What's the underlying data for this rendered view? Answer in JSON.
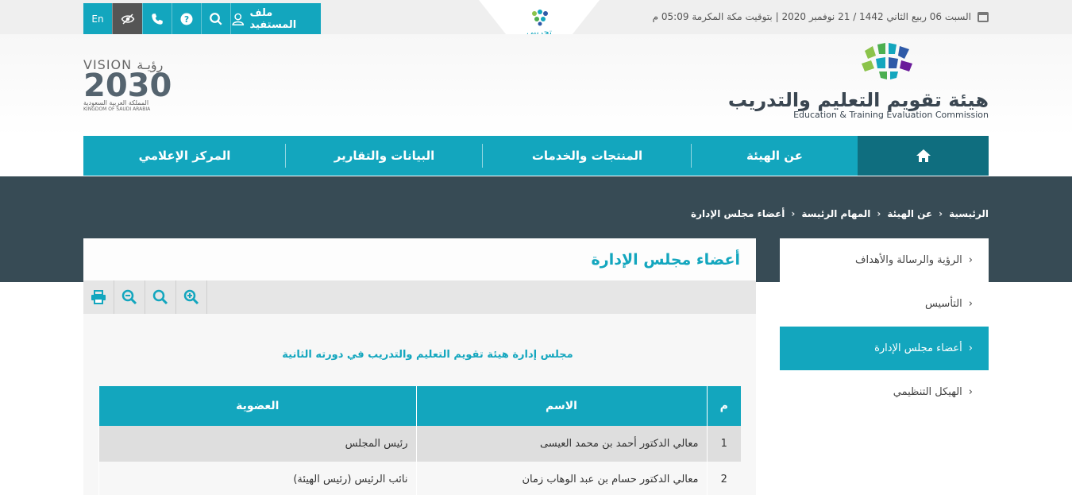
{
  "topbar": {
    "date_text": "السبت 06 ربيع الثاني 1442 / 21 نوفمبر 2020 | بتوقيت مكة المكرمة 05:09 م",
    "lang_label": "En",
    "profile_label": "ملف المستفيد",
    "tajribi_label": "تجريبي",
    "icons": [
      "accessibility-icon",
      "phone-icon",
      "help-icon",
      "search-icon",
      "user-icon"
    ]
  },
  "logo": {
    "ar": "هيئة تقويم التعليم والتدريب",
    "en": "Education & Training Evaluation Commission"
  },
  "vision": {
    "line1": "VISION رؤيـة",
    "line2": "2030",
    "line3": "المملكة العربية السعودية",
    "line4": "KINGDOM OF SAUDI ARABIA"
  },
  "nav": {
    "items": [
      "عن الهيئة",
      "المنتجات والخدمات",
      "البيانات والتقارير",
      "المركز الإعلامي"
    ]
  },
  "breadcrumb": [
    "الرئيسية",
    "عن الهيئة",
    "المهام الرئيسة",
    "أعضاء مجلس الإدارة"
  ],
  "side_menu": {
    "items": [
      "الرؤية والرسالة والأهداف",
      "التأسيس",
      "أعضاء مجلس الإدارة",
      "الهيكل التنظيمي"
    ],
    "active_index": 2
  },
  "page": {
    "title": "أعضاء مجلس الإدارة",
    "subtitle": "مجلس إدارة هيئة تقويم التعليم والتدريب في دورته الثانية"
  },
  "table": {
    "headers": [
      "م",
      "الاسم",
      "العضوية"
    ],
    "rows": [
      [
        "1",
        "معالي الدكتور أحمد بن محمد العيسى",
        "رئيس المجلس"
      ],
      [
        "2",
        "معالي الدكتور حسام بن عبد الوهاب زمان",
        "نائب الرئيس (رئيس الهيئة)"
      ]
    ]
  },
  "colors": {
    "accent": "#13a6be",
    "dark_band": "#374b55",
    "home_tab": "#0f6e7f"
  }
}
